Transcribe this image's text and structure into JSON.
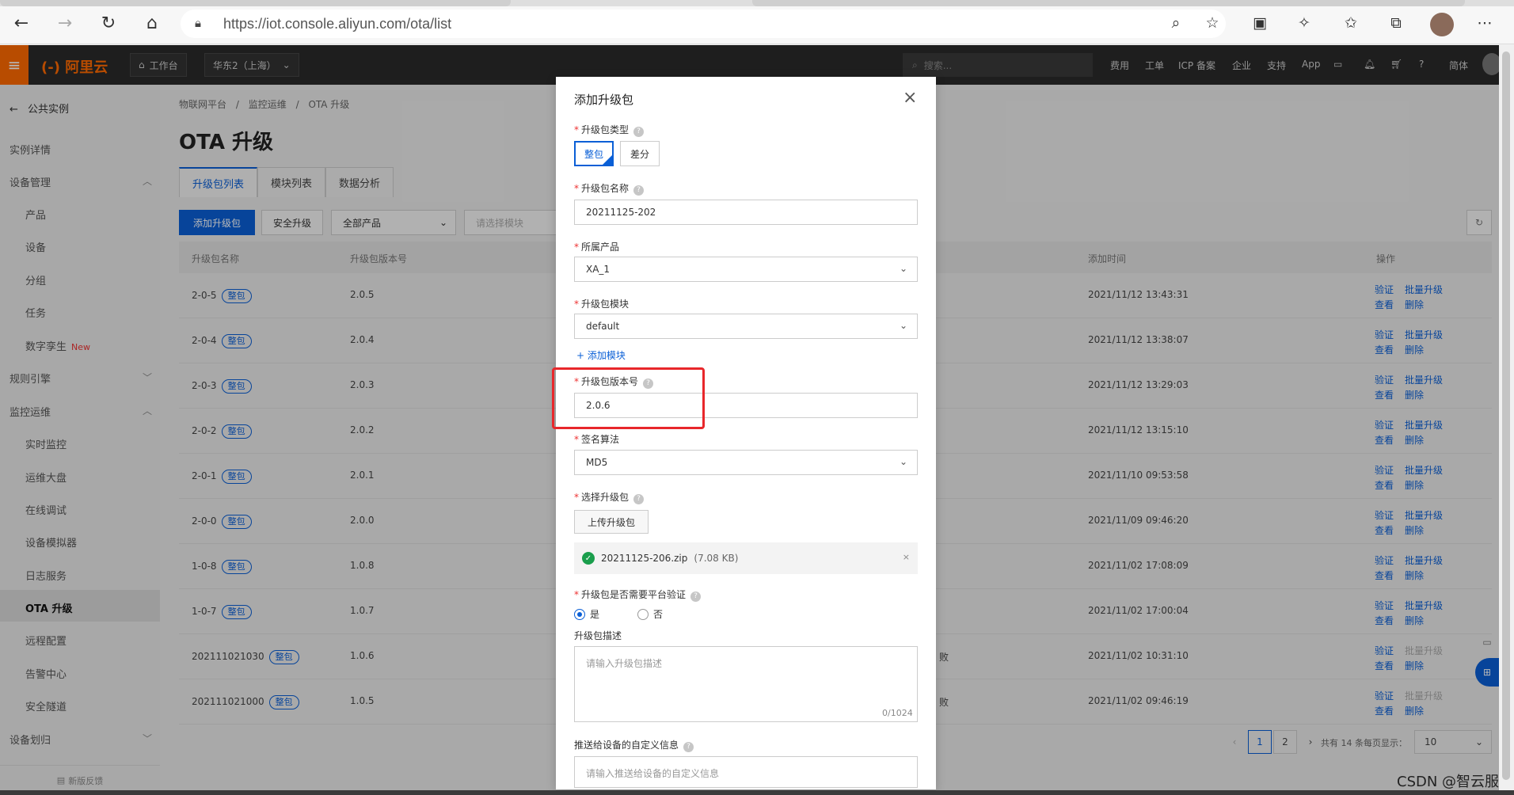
{
  "browser": {
    "url": "https://iot.console.aliyun.com/ota/list"
  },
  "topbar": {
    "logo": "(-) 阿里云",
    "workbench": "工作台",
    "region": "华东2（上海）",
    "search_placeholder": "搜索...",
    "right_items": [
      "费用",
      "工单",
      "ICP 备案",
      "企业",
      "支持",
      "App",
      "简体"
    ]
  },
  "sidebar": {
    "back_label": "公共实例",
    "items": [
      {
        "label": "实例详情",
        "level": 0
      },
      {
        "label": "设备管理",
        "level": 0,
        "chevron": "up"
      },
      {
        "label": "产品",
        "level": 1
      },
      {
        "label": "设备",
        "level": 1
      },
      {
        "label": "分组",
        "level": 1
      },
      {
        "label": "任务",
        "level": 1
      },
      {
        "label": "数字孪生",
        "level": 1,
        "badge": "New"
      },
      {
        "label": "规则引擎",
        "level": 0,
        "chevron": "down"
      },
      {
        "label": "监控运维",
        "level": 0,
        "chevron": "up"
      },
      {
        "label": "实时监控",
        "level": 1
      },
      {
        "label": "运维大盘",
        "level": 1
      },
      {
        "label": "在线调试",
        "level": 1
      },
      {
        "label": "设备模拟器",
        "level": 1
      },
      {
        "label": "日志服务",
        "level": 1
      },
      {
        "label": "OTA 升级",
        "level": 1,
        "active": true
      },
      {
        "label": "远程配置",
        "level": 1
      },
      {
        "label": "告警中心",
        "level": 1
      },
      {
        "label": "安全隧道",
        "level": 1
      },
      {
        "label": "设备划归",
        "level": 0,
        "chevron": "down"
      }
    ],
    "feedback": "新版反馈"
  },
  "main": {
    "breadcrumb": [
      "物联网平台",
      "监控运维",
      "OTA 升级"
    ],
    "title": "OTA 升级",
    "tabs": [
      "升级包列表",
      "模块列表",
      "数据分析"
    ],
    "add_button": "添加升级包",
    "secure_button": "安全升级",
    "product_select": "全部产品",
    "module_select": "请选择模块",
    "columns": [
      "升级包名称",
      "升级包版本号",
      "添加时间",
      "操作"
    ],
    "rows": [
      {
        "name": "2-0-5",
        "badge": "整包",
        "version": "2.0.5",
        "time": "2021/11/12 13:43:31",
        "partial": "",
        "batch_enabled": true
      },
      {
        "name": "2-0-4",
        "badge": "整包",
        "version": "2.0.4",
        "time": "2021/11/12 13:38:07",
        "partial": "",
        "batch_enabled": true
      },
      {
        "name": "2-0-3",
        "badge": "整包",
        "version": "2.0.3",
        "time": "2021/11/12 13:29:03",
        "partial": "",
        "batch_enabled": true
      },
      {
        "name": "2-0-2",
        "badge": "整包",
        "version": "2.0.2",
        "time": "2021/11/12 13:15:10",
        "partial": "",
        "batch_enabled": true
      },
      {
        "name": "2-0-1",
        "badge": "整包",
        "version": "2.0.1",
        "time": "2021/11/10 09:53:58",
        "partial": "",
        "batch_enabled": true
      },
      {
        "name": "2-0-0",
        "badge": "整包",
        "version": "2.0.0",
        "time": "2021/11/09 09:46:20",
        "partial": "",
        "batch_enabled": true
      },
      {
        "name": "1-0-8",
        "badge": "整包",
        "version": "1.0.8",
        "time": "2021/11/02 17:08:09",
        "partial": "",
        "batch_enabled": true
      },
      {
        "name": "1-0-7",
        "badge": "整包",
        "version": "1.0.7",
        "time": "2021/11/02 17:00:04",
        "partial": "",
        "batch_enabled": true
      },
      {
        "name": "202111021030",
        "badge": "整包",
        "version": "1.0.6",
        "time": "2021/11/02 10:31:10",
        "partial": "败",
        "batch_enabled": false
      },
      {
        "name": "202111021000",
        "badge": "整包",
        "version": "1.0.5",
        "time": "2021/11/02 09:46:19",
        "partial": "败",
        "batch_enabled": false
      }
    ],
    "ops": {
      "verify": "验证",
      "batch": "批量升级",
      "view": "查看",
      "delete": "删除"
    },
    "pagination": {
      "pages": [
        "1",
        "2"
      ],
      "current": "1",
      "summary": "共有 14 条每页显示：",
      "page_size": "10"
    }
  },
  "dialog": {
    "title": "添加升级包",
    "type_label": "升级包类型",
    "type_options": [
      "整包",
      "差分"
    ],
    "name_label": "升级包名称",
    "name_value": "20211125-202",
    "product_label": "所属产品",
    "product_value": "XA_1",
    "module_label": "升级包模块",
    "module_value": "default",
    "add_module": "+ 添加模块",
    "version_label": "升级包版本号",
    "version_value": "2.0.6",
    "sign_label": "签名算法",
    "sign_value": "MD5",
    "select_label": "选择升级包",
    "upload_button": "上传升级包",
    "file_name": "20211125-206.zip",
    "file_size": "(7.08 KB)",
    "verify_label": "升级包是否需要平台验证",
    "verify_yes": "是",
    "verify_no": "否",
    "desc_label": "升级包描述",
    "desc_placeholder": "请输入升级包描述",
    "desc_counter": "0/1024",
    "custom_label": "推送给设备的自定义信息",
    "custom_placeholder": "请输入推送给设备的自定义信息"
  },
  "watermark": "CSDN @智云服",
  "colors": {
    "accent": "#0a5fd6",
    "brand": "#ff6a00",
    "highlight": "#e8272b",
    "success": "#1a9e4c"
  }
}
